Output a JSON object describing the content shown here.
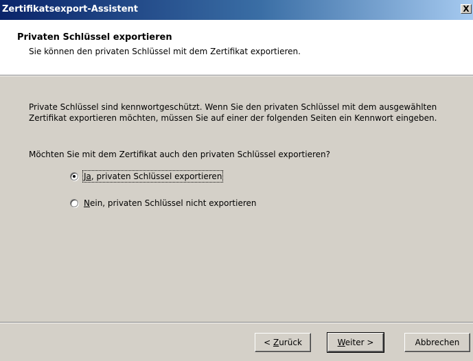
{
  "window": {
    "title": "Zertifikatsexport-Assistent",
    "close_glyph": "X"
  },
  "header": {
    "title": "Privaten Schlüssel exportieren",
    "subtitle": "Sie können den privaten Schlüssel mit dem Zertifikat exportieren."
  },
  "content": {
    "description": "Private Schlüssel sind kennwortgeschützt. Wenn Sie den privaten Schlüssel mit dem ausgewählten Zertifikat exportieren möchten, müssen Sie auf einer der folgenden Seiten ein Kennwort eingeben.",
    "question": "Möchten Sie mit dem Zertifikat auch den privaten Schlüssel exportieren?",
    "options": [
      {
        "accel": "J",
        "accel_suffix": "a",
        "rest": ", privaten Schlüssel exportieren",
        "selected": true
      },
      {
        "accel": "N",
        "accel_suffix": "",
        "rest": "ein, privaten Schlüssel nicht exportieren",
        "selected": false
      }
    ]
  },
  "buttons": {
    "back": {
      "prefix": "< ",
      "accel": "Z",
      "rest": "urück"
    },
    "next": {
      "prefix": "",
      "accel": "W",
      "rest": "eiter >"
    },
    "cancel": {
      "label": "Abbrechen"
    }
  }
}
